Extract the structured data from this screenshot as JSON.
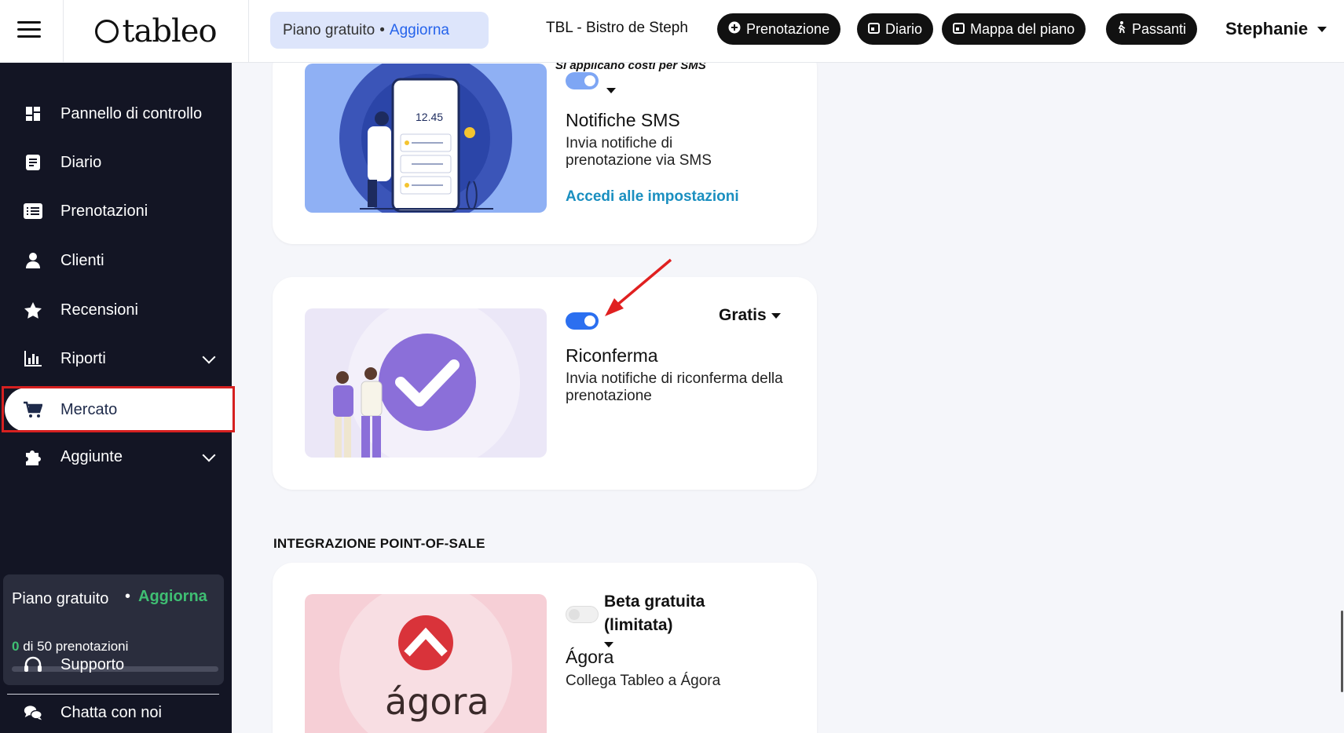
{
  "header": {
    "logo": "tableo",
    "plan_label": "Piano gratuito",
    "plan_separator": "•",
    "plan_upgrade": "Aggiorna",
    "restaurant": "TBL - Bistro de Steph",
    "buttons": [
      {
        "label": "Prenotazione",
        "icon": "plus-circle-icon"
      },
      {
        "label": "Diario",
        "icon": "calendar-icon"
      },
      {
        "label": "Mappa del piano",
        "icon": "calendar-icon"
      },
      {
        "label": "Passanti",
        "icon": "walking-icon"
      }
    ],
    "user": "Stephanie"
  },
  "sidebar": {
    "items": [
      {
        "label": "Pannello di controllo",
        "icon": "dashboard-icon"
      },
      {
        "label": "Diario",
        "icon": "book-icon"
      },
      {
        "label": "Prenotazioni",
        "icon": "list-icon"
      },
      {
        "label": "Clienti",
        "icon": "user-icon"
      },
      {
        "label": "Recensioni",
        "icon": "star-icon"
      },
      {
        "label": "Riporti",
        "icon": "bar-chart-icon"
      },
      {
        "label": "Mercato",
        "icon": "cart-icon"
      },
      {
        "label": "Aggiunte",
        "icon": "puzzle-icon"
      },
      {
        "label": "Supporto",
        "icon": "headset-icon"
      },
      {
        "label": "Chatta con noi",
        "icon": "chat-icon"
      }
    ],
    "plan": {
      "title": "Piano gratuito",
      "upgrade": "Aggiorna",
      "used": "0",
      "count_text": "di 50 prenotazioni",
      "usage_fraction": 0
    }
  },
  "main": {
    "sms_card": {
      "cost_note": "Si applicano costi per SMS",
      "title": "Notifiche SMS",
      "description": "Invia notifiche di prenotazione via SMS",
      "link": "Accedi alle impostazioni",
      "clock": "12.45"
    },
    "reconfirm_card": {
      "price": "Gratis",
      "title": "Riconferma",
      "description": "Invia notifiche di riconferma della prenotazione"
    },
    "pos_section_title": "INTEGRAZIONE POINT-OF-SALE",
    "agora_card": {
      "price": "Beta gratuita (limitata)",
      "title": "Ágora",
      "description": "Collega Tableo a Ágora",
      "logo_text": "ágora"
    }
  },
  "colors": {
    "sidebar_bg": "#131524",
    "accent_blue": "#2b6ff0",
    "upgrade_green": "#3fbf73",
    "link_blue": "#1a8fc0",
    "highlight_red": "#d62020"
  }
}
